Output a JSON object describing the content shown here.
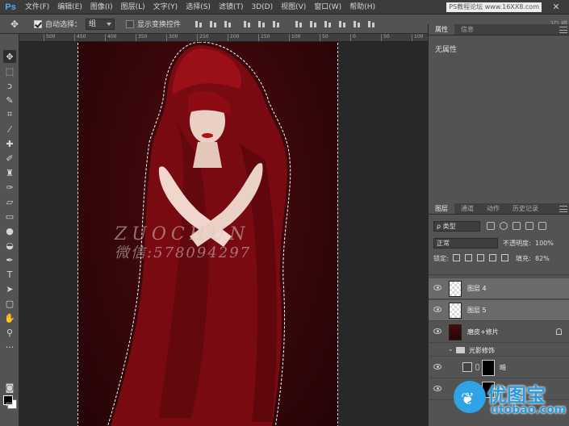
{
  "menubar": {
    "logo": "Ps",
    "items": [
      "文件(F)",
      "编辑(E)",
      "图像(I)",
      "图层(L)",
      "文字(Y)",
      "选择(S)",
      "滤镜(T)",
      "3D(D)",
      "视图(V)",
      "窗口(W)",
      "帮助(H)"
    ],
    "site_watermark": "PS教程论坛 www.16XX8.com",
    "close_glyph": "✕"
  },
  "options": {
    "auto_select_label": "自动选择：",
    "auto_select_value": "组",
    "show_transform_label": "显示变换控件",
    "mode_3d": "3D 模"
  },
  "ruler": {
    "ticks": [
      "500",
      "450",
      "400",
      "350",
      "300",
      "250",
      "200",
      "150",
      "100",
      "50",
      "0",
      "50",
      "100"
    ]
  },
  "canvas": {
    "watermark_line1": "ZUOCHUN",
    "watermark_line2": "微信:578094297"
  },
  "properties_panel": {
    "tabs": [
      "属性",
      "信息"
    ],
    "empty_text": "无属性"
  },
  "layers_panel": {
    "tabs": [
      "图层",
      "通道",
      "动作",
      "历史记录"
    ],
    "filter_kind": "ρ 类型",
    "blend_mode": "正常",
    "opacity_label": "不透明度:",
    "opacity_value": "100%",
    "lock_label": "锁定:",
    "fill_label": "填充:",
    "fill_value": "82%",
    "layers": [
      {
        "name": "图层 4",
        "selected": true,
        "thumb": "checker"
      },
      {
        "name": "图层 5",
        "selected": true,
        "thumb": "checker"
      },
      {
        "name": "磨皮+修片",
        "selected": false,
        "thumb": "red",
        "locked": true
      },
      {
        "name": "光影修饰",
        "selected": false,
        "type": "group"
      },
      {
        "name": "暗",
        "selected": false,
        "type": "adjustment"
      },
      {
        "name": "亮",
        "selected": false,
        "type": "adjustment"
      }
    ]
  },
  "site_logo": {
    "text": "优图宝",
    "domain": "utobao.com"
  }
}
